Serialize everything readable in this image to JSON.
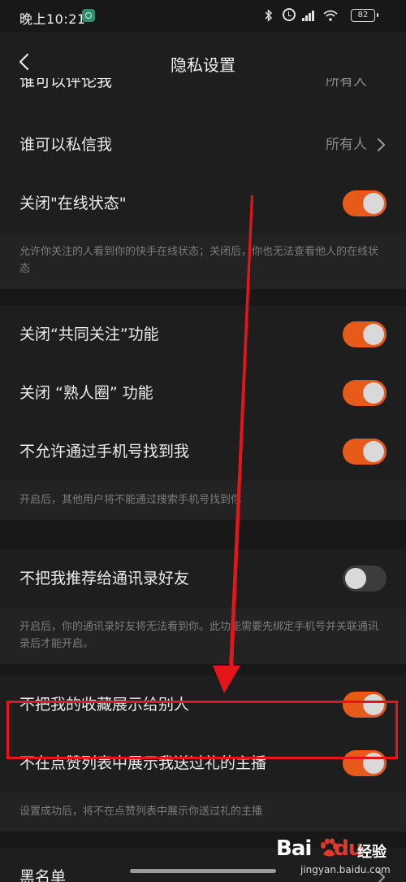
{
  "status_bar": {
    "time": "晚上10:21",
    "battery": "82"
  },
  "header": {
    "title": "隐私设置"
  },
  "partial_row": {
    "label": "谁可以评论我",
    "value": "所有人"
  },
  "rows": {
    "dm": {
      "label": "谁可以私信我",
      "value": "所有人"
    },
    "online": {
      "label": "关闭\"在线状态\"",
      "on": true
    },
    "online_note": "允许你关注的人看到你的快手在线状态；关闭后，你也无法查看他人的在线状态",
    "mutual": {
      "label": "关闭“共同关注”功能",
      "on": true
    },
    "acquaint": {
      "label": "关闭 “熟人圈” 功能",
      "on": true
    },
    "phone": {
      "label": "不允许通过手机号找到我",
      "on": true
    },
    "phone_note": "开启后，其他用户将不能通过搜索手机号找到你",
    "contacts": {
      "label": "不把我推荐给通讯录好友",
      "on": false
    },
    "contacts_note": "开启后，你的通讯录好友将无法看到你。此功能需要先绑定手机号并关联通讯录后才能开启。",
    "favorites": {
      "label": "不把我的收藏展示给别人",
      "on": true
    },
    "gifts": {
      "label": "不在点赞列表中展示我送过礼的主播",
      "on": true
    },
    "gifts_note": "设置成功后，将不在点赞列表中展示你送过礼的主播",
    "blacklist": {
      "label": "黑名单"
    }
  },
  "watermark": {
    "brand_a": "Bai",
    "brand_b": "du",
    "brand_c": "经验",
    "url": "jingyan.baidu.com"
  },
  "colors": {
    "accent": "#e85a1a",
    "annotation": "#e5161b",
    "background": "#1e1e1e"
  },
  "icons": [
    "back-arrow-icon",
    "chevron-right-icon",
    "bluetooth-icon",
    "alarm-icon",
    "signal-icon",
    "wifi-icon",
    "battery-icon"
  ]
}
